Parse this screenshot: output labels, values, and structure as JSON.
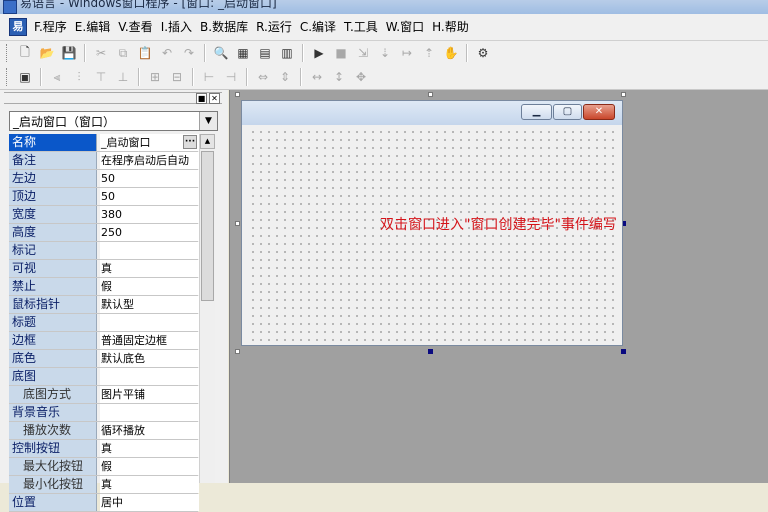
{
  "window": {
    "title": "易语言 - Windows窗口程序 - [窗口: _启动窗口]"
  },
  "menu": [
    "F.程序",
    "E.编辑",
    "V.查看",
    "I.插入",
    "B.数据库",
    "R.运行",
    "C.编译",
    "T.工具",
    "W.窗口",
    "H.帮助"
  ],
  "toolbar1_icons": [
    "new-file-icon",
    "open-folder-icon",
    "save-icon",
    "cut-icon",
    "copy-icon",
    "paste-icon",
    "undo-icon",
    "redo-icon",
    "find-icon",
    "layout-1-icon",
    "layout-2-icon",
    "layout-3-icon",
    "run-icon",
    "stop-icon",
    "step-1-icon",
    "step-2-icon",
    "step-3-icon",
    "step-4-icon",
    "hand-icon",
    "debug-icon"
  ],
  "toolbar2_icons": [
    "form-icon",
    "align-left-icon",
    "align-center-icon",
    "align-top-icon",
    "align-middle-icon",
    "h-center-icon",
    "v-center-icon",
    "same-width-icon",
    "same-height-icon",
    "h-space-icon",
    "v-space-icon",
    "width-icon",
    "height-icon",
    "size-icon"
  ],
  "panel": {
    "selector_value": "_启动窗口（窗口）",
    "properties": [
      {
        "key": "名称",
        "value": "_启动窗口",
        "selected": true,
        "sub": false,
        "has_button": true
      },
      {
        "key": "备注",
        "value": "在程序启动后自动",
        "selected": false,
        "sub": false
      },
      {
        "key": "左边",
        "value": "50",
        "selected": false,
        "sub": false
      },
      {
        "key": "顶边",
        "value": "50",
        "selected": false,
        "sub": false
      },
      {
        "key": "宽度",
        "value": "380",
        "selected": false,
        "sub": false
      },
      {
        "key": "高度",
        "value": "250",
        "selected": false,
        "sub": false
      },
      {
        "key": "标记",
        "value": "",
        "selected": false,
        "sub": false
      },
      {
        "key": "可视",
        "value": "真",
        "selected": false,
        "sub": false
      },
      {
        "key": "禁止",
        "value": "假",
        "selected": false,
        "sub": false
      },
      {
        "key": "鼠标指针",
        "value": "默认型",
        "selected": false,
        "sub": false
      },
      {
        "key": "标题",
        "value": "",
        "selected": false,
        "sub": false
      },
      {
        "key": "边框",
        "value": "普通固定边框",
        "selected": false,
        "sub": false
      },
      {
        "key": "底色",
        "value": "默认底色",
        "selected": false,
        "sub": false
      },
      {
        "key": "底图",
        "value": "",
        "selected": false,
        "sub": false
      },
      {
        "key": "底图方式",
        "value": "图片平铺",
        "selected": false,
        "sub": true
      },
      {
        "key": "背景音乐",
        "value": "",
        "selected": false,
        "sub": false
      },
      {
        "key": "播放次数",
        "value": "循环播放",
        "selected": false,
        "sub": true
      },
      {
        "key": "控制按钮",
        "value": "真",
        "selected": false,
        "sub": false
      },
      {
        "key": "最大化按钮",
        "value": "假",
        "selected": false,
        "sub": true
      },
      {
        "key": "最小化按钮",
        "value": "真",
        "selected": false,
        "sub": true
      },
      {
        "key": "位置",
        "value": "居中",
        "selected": false,
        "sub": false
      }
    ]
  },
  "designer": {
    "hint": "双击窗口进入\"窗口创建完毕\"事件编写",
    "caption_buttons": {
      "min": "▁",
      "max": "▢",
      "close": "✕"
    }
  }
}
